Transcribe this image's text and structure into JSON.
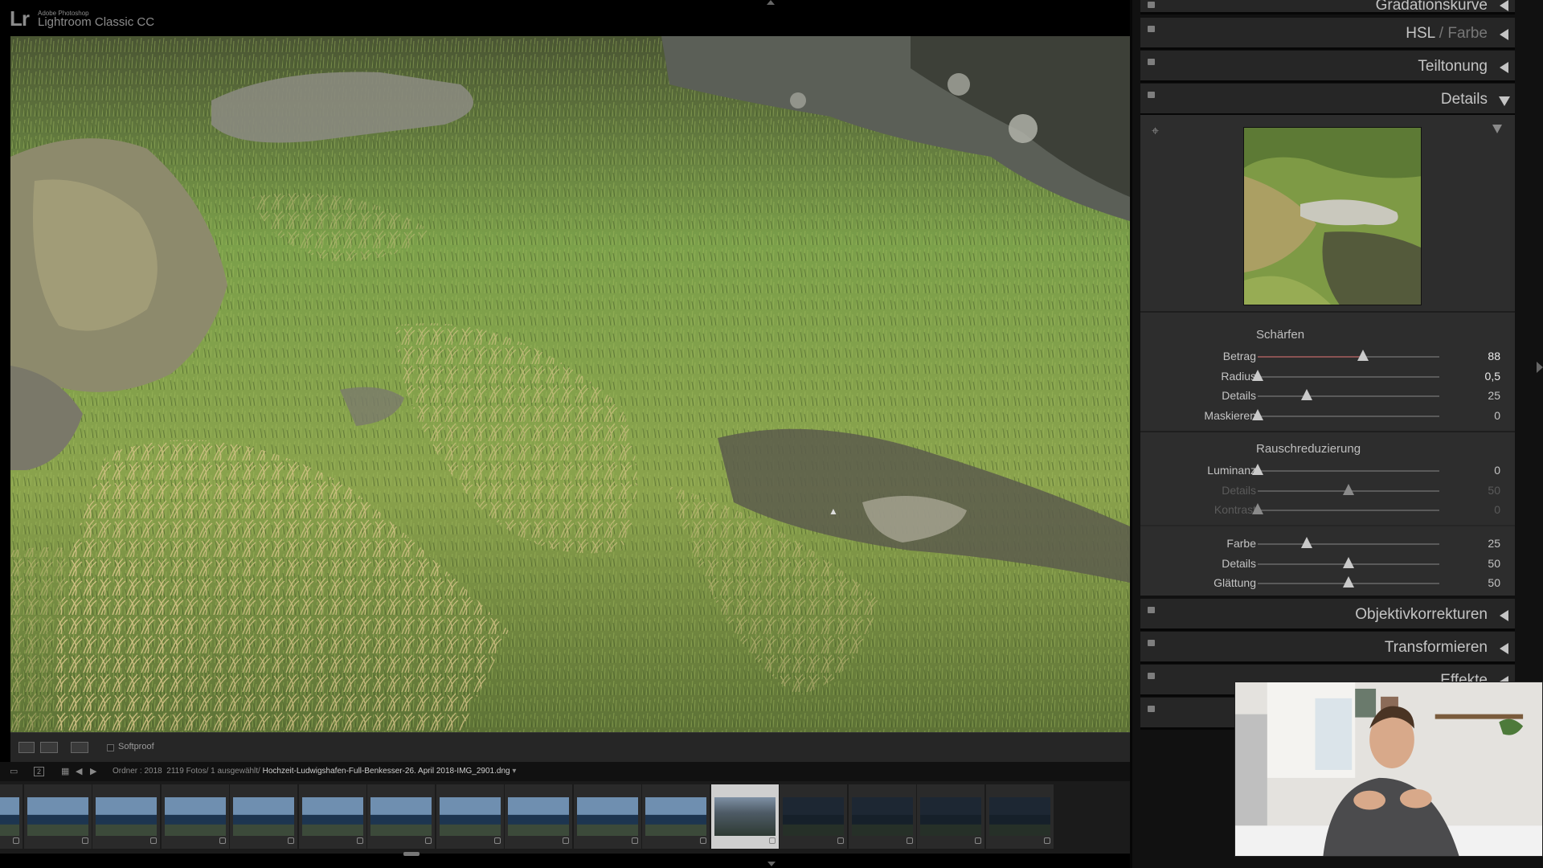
{
  "window": {
    "logo": "Lr",
    "brand_small": "Adobe Photoshop",
    "brand_name": "Lightroom Classic CC"
  },
  "toolbar": {
    "softproof_label": "Softproof"
  },
  "infobar": {
    "folder_text": "Ordner : 2018",
    "count_text": "2119 Fotos/ 1 ausgewählt/",
    "filename": "Hochzeit-Ludwigshafen-Full-Benkesser-26. April 2018-IMG_2901.dng",
    "second_monitor": "2"
  },
  "filmstrip": {
    "thumbnail_count": 16,
    "selected_index": 11
  },
  "panel": {
    "sections": {
      "gradation": "Gradationskurve",
      "hsl": "HSL",
      "hsl_sep": " / ",
      "farbe": "Farbe",
      "teiltonung": "Teiltonung",
      "details": "Details",
      "objektiv": "Objektivkorrekturen",
      "transform": "Transformieren",
      "effekte": "Effekte"
    },
    "sharpen": {
      "title": "Schärfen",
      "rows": [
        {
          "label": "Betrag",
          "value": "88",
          "pos": 0.58
        },
        {
          "label": "Radius",
          "value": "0,5",
          "pos": 0.0
        },
        {
          "label": "Details",
          "value": "25",
          "pos": 0.27
        },
        {
          "label": "Maskieren",
          "value": "0",
          "pos": 0.0
        }
      ]
    },
    "noise": {
      "title": "Rauschreduzierung",
      "rows": [
        {
          "label": "Luminanz",
          "value": "0",
          "pos": 0.0
        },
        {
          "label": "Details",
          "value": "50",
          "pos": 0.5
        },
        {
          "label": "Kontrast",
          "value": "0",
          "pos": 0.0
        },
        {
          "label": "Farbe",
          "value": "25",
          "pos": 0.27
        },
        {
          "label": "Details",
          "value": "50",
          "pos": 0.5
        },
        {
          "label": "Glättung",
          "value": "50",
          "pos": 0.5
        }
      ]
    }
  },
  "colors": {
    "panel_bg": "#2d2d2d",
    "accent_fill": "#8a5252"
  }
}
